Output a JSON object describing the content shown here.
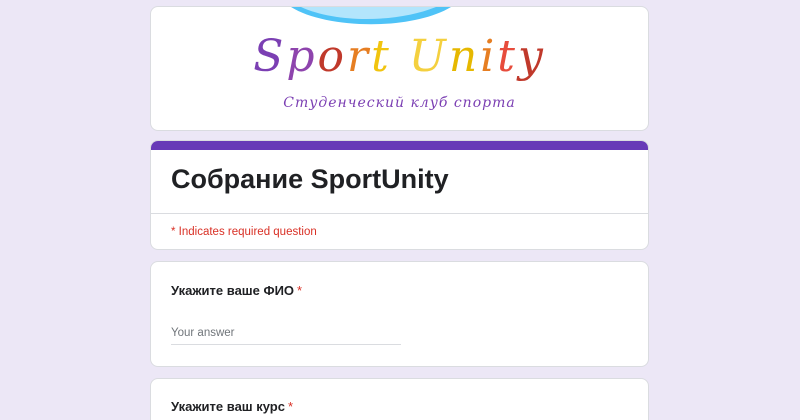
{
  "banner": {
    "logo_title": "Sport Unity",
    "logo_subtitle": "Студенческий клуб спорта",
    "logo_letter_colors": [
      "#7b3fb3",
      "#8e44ad",
      "#c0392b",
      "#e67e22",
      "#f1c40f",
      "#f4d03f",
      "#e6b800",
      "#e67e22",
      "#e74c3c",
      "#c0392b",
      "#d35400"
    ],
    "wave_colors": [
      "#4fc3f7",
      "#29b6f6"
    ]
  },
  "form": {
    "title": "Собрание SportUnity",
    "required_note": "* Indicates required question",
    "accent_color": "#673ab7"
  },
  "questions": [
    {
      "label": "Укажите ваше ФИО",
      "required_mark": "*",
      "placeholder": "Your answer"
    },
    {
      "label": "Укажите ваш курс",
      "required_mark": "*"
    }
  ]
}
